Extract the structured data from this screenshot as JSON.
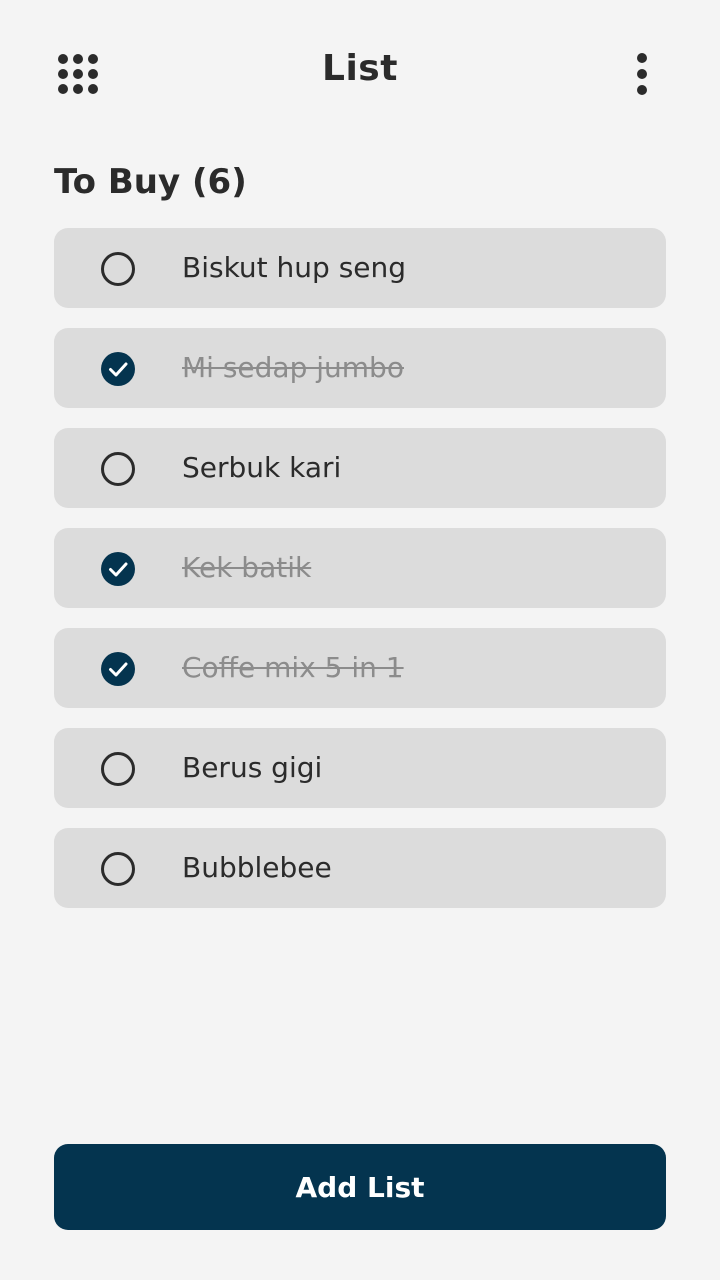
{
  "header": {
    "title": "List",
    "menu_icon": "grid-menu-icon",
    "more_icon": "more-vertical-icon"
  },
  "section": {
    "title": "To Buy (6)"
  },
  "items": [
    {
      "label": "Biskut hup seng",
      "checked": false
    },
    {
      "label": "Mi sedap jumbo",
      "checked": true
    },
    {
      "label": "Serbuk kari",
      "checked": false
    },
    {
      "label": "Kek batik",
      "checked": true
    },
    {
      "label": "Coffe mix 5 in 1",
      "checked": true
    },
    {
      "label": "Berus gigi",
      "checked": false
    },
    {
      "label": "Bubblebee",
      "checked": false
    }
  ],
  "add_button": {
    "label": "Add List"
  },
  "colors": {
    "background": "#f4f4f4",
    "item_background": "#dcdcdc",
    "accent": "#04344f",
    "text": "#2b2b2b",
    "done_text": "#8c8c8c"
  }
}
